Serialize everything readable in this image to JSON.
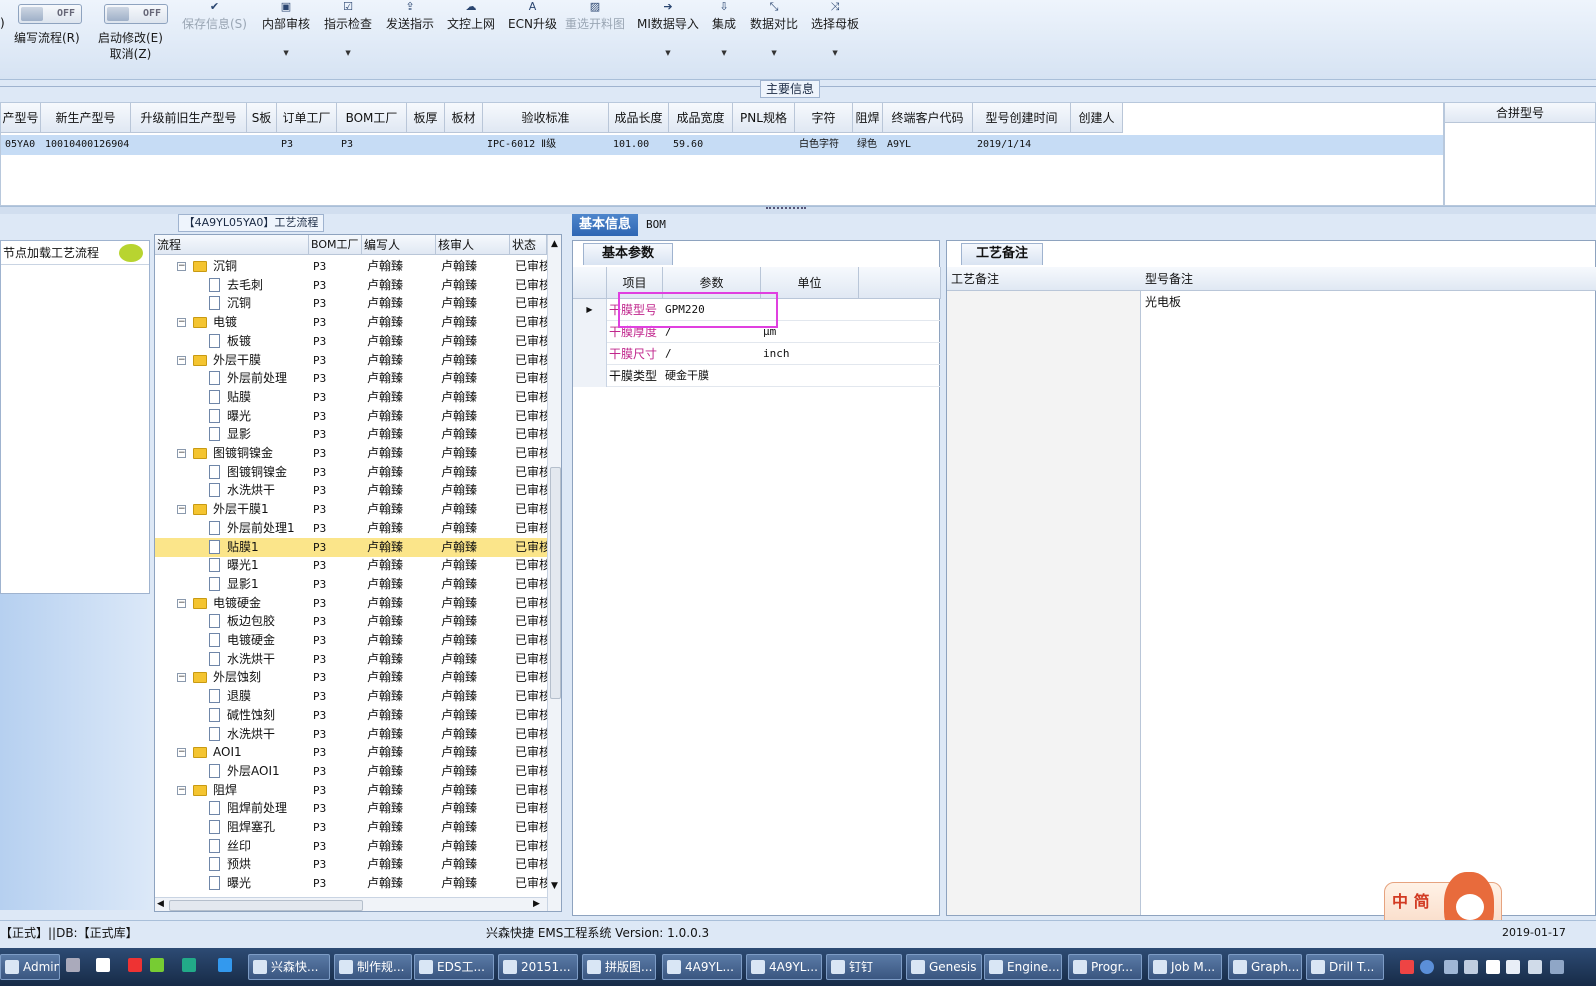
{
  "ribbon": {
    "toggle1": "OFF",
    "toggle2": "OFF",
    "btn_edit_flow": "编写流程(R)",
    "btn_start_edit": "启动修改(E)",
    "btn_cancel": "取消(Z)",
    "btn_save": "保存信息(S)",
    "btn_internal_review": "内部审核",
    "btn_check": "指示检查",
    "btn_send": "发送指示",
    "btn_upload": "文控上网",
    "btn_ecn": "ECN升级",
    "btn_reselect": "重选开料图",
    "btn_mi_import": "MI数据导入",
    "btn_integrate": "集成",
    "btn_compare": "数据对比",
    "btn_select_mother": "选择母板"
  },
  "main_info": {
    "title": "主要信息",
    "columns": [
      "产型号",
      "新生产型号",
      "升级前旧生产型号",
      "S板",
      "订单工厂",
      "BOM工厂",
      "板厚",
      "板材",
      "验收标准",
      "成品长度",
      "成品宽度",
      "PNL规格",
      "字符",
      "阻焊",
      "终端客户代码",
      "型号创建时间",
      "创建人"
    ],
    "row": [
      "05YA0",
      "10010400126904",
      "",
      "",
      "P3",
      "P3",
      "",
      "",
      "IPC-6012 Ⅱ级",
      "101.00",
      "59.60",
      "",
      "白色字符",
      "绿色",
      "A9YL",
      "2019/1/14",
      ""
    ],
    "merge_header": "合拼型号"
  },
  "left_panel": {
    "title": "节点加载工艺流程"
  },
  "tree_panel": {
    "tab": "【4A9YL05YA0】工艺流程",
    "headers": [
      "流程",
      "BOM工厂",
      "编写人",
      "核审人",
      "状态"
    ],
    "rows": [
      {
        "name": "沉铜",
        "type": "folder",
        "bom": "P3",
        "writer": "卢翰臻",
        "reviewer": "卢翰臻",
        "status": "已审核"
      },
      {
        "name": "去毛刺",
        "type": "doc",
        "bom": "P3",
        "writer": "卢翰臻",
        "reviewer": "卢翰臻",
        "status": "已审核"
      },
      {
        "name": "沉铜",
        "type": "doc",
        "bom": "P3",
        "writer": "卢翰臻",
        "reviewer": "卢翰臻",
        "status": "已审核"
      },
      {
        "name": "电镀",
        "type": "folder",
        "bom": "P3",
        "writer": "卢翰臻",
        "reviewer": "卢翰臻",
        "status": "已审核"
      },
      {
        "name": "板镀",
        "type": "doc",
        "bom": "P3",
        "writer": "卢翰臻",
        "reviewer": "卢翰臻",
        "status": "已审核"
      },
      {
        "name": "外层干膜",
        "type": "folder",
        "bom": "P3",
        "writer": "卢翰臻",
        "reviewer": "卢翰臻",
        "status": "已审核"
      },
      {
        "name": "外层前处理",
        "type": "doc",
        "bom": "P3",
        "writer": "卢翰臻",
        "reviewer": "卢翰臻",
        "status": "已审核"
      },
      {
        "name": "贴膜",
        "type": "doc",
        "bom": "P3",
        "writer": "卢翰臻",
        "reviewer": "卢翰臻",
        "status": "已审核"
      },
      {
        "name": "曝光",
        "type": "doc",
        "bom": "P3",
        "writer": "卢翰臻",
        "reviewer": "卢翰臻",
        "status": "已审核"
      },
      {
        "name": "显影",
        "type": "doc",
        "bom": "P3",
        "writer": "卢翰臻",
        "reviewer": "卢翰臻",
        "status": "已审核"
      },
      {
        "name": "图镀铜镍金",
        "type": "folder",
        "bom": "P3",
        "writer": "卢翰臻",
        "reviewer": "卢翰臻",
        "status": "已审核"
      },
      {
        "name": "图镀铜镍金",
        "type": "doc",
        "bom": "P3",
        "writer": "卢翰臻",
        "reviewer": "卢翰臻",
        "status": "已审核"
      },
      {
        "name": "水洗烘干",
        "type": "doc",
        "bom": "P3",
        "writer": "卢翰臻",
        "reviewer": "卢翰臻",
        "status": "已审核"
      },
      {
        "name": "外层干膜1",
        "type": "folder",
        "bom": "P3",
        "writer": "卢翰臻",
        "reviewer": "卢翰臻",
        "status": "已审核"
      },
      {
        "name": "外层前处理1",
        "type": "doc",
        "bom": "P3",
        "writer": "卢翰臻",
        "reviewer": "卢翰臻",
        "status": "已审核"
      },
      {
        "name": "贴膜1",
        "type": "doc",
        "bom": "P3",
        "writer": "卢翰臻",
        "reviewer": "卢翰臻",
        "status": "已审核",
        "selected": true
      },
      {
        "name": "曝光1",
        "type": "doc",
        "bom": "P3",
        "writer": "卢翰臻",
        "reviewer": "卢翰臻",
        "status": "已审核"
      },
      {
        "name": "显影1",
        "type": "doc",
        "bom": "P3",
        "writer": "卢翰臻",
        "reviewer": "卢翰臻",
        "status": "已审核"
      },
      {
        "name": "电镀硬金",
        "type": "folder",
        "bom": "P3",
        "writer": "卢翰臻",
        "reviewer": "卢翰臻",
        "status": "已审核"
      },
      {
        "name": "板边包胶",
        "type": "doc",
        "bom": "P3",
        "writer": "卢翰臻",
        "reviewer": "卢翰臻",
        "status": "已审核"
      },
      {
        "name": "电镀硬金",
        "type": "doc",
        "bom": "P3",
        "writer": "卢翰臻",
        "reviewer": "卢翰臻",
        "status": "已审核"
      },
      {
        "name": "水洗烘干",
        "type": "doc",
        "bom": "P3",
        "writer": "卢翰臻",
        "reviewer": "卢翰臻",
        "status": "已审核"
      },
      {
        "name": "外层蚀刻",
        "type": "folder",
        "bom": "P3",
        "writer": "卢翰臻",
        "reviewer": "卢翰臻",
        "status": "已审核"
      },
      {
        "name": "退膜",
        "type": "doc",
        "bom": "P3",
        "writer": "卢翰臻",
        "reviewer": "卢翰臻",
        "status": "已审核"
      },
      {
        "name": "碱性蚀刻",
        "type": "doc",
        "bom": "P3",
        "writer": "卢翰臻",
        "reviewer": "卢翰臻",
        "status": "已审核"
      },
      {
        "name": "水洗烘干",
        "type": "doc",
        "bom": "P3",
        "writer": "卢翰臻",
        "reviewer": "卢翰臻",
        "status": "已审核"
      },
      {
        "name": "AOI1",
        "type": "folder",
        "bom": "P3",
        "writer": "卢翰臻",
        "reviewer": "卢翰臻",
        "status": "已审核"
      },
      {
        "name": "外层AOI1",
        "type": "doc",
        "bom": "P3",
        "writer": "卢翰臻",
        "reviewer": "卢翰臻",
        "status": "已审核"
      },
      {
        "name": "阻焊",
        "type": "folder",
        "bom": "P3",
        "writer": "卢翰臻",
        "reviewer": "卢翰臻",
        "status": "已审核"
      },
      {
        "name": "阻焊前处理",
        "type": "doc",
        "bom": "P3",
        "writer": "卢翰臻",
        "reviewer": "卢翰臻",
        "status": "已审核"
      },
      {
        "name": "阻焊塞孔",
        "type": "doc",
        "bom": "P3",
        "writer": "卢翰臻",
        "reviewer": "卢翰臻",
        "status": "已审核"
      },
      {
        "name": "丝印",
        "type": "doc",
        "bom": "P3",
        "writer": "卢翰臻",
        "reviewer": "卢翰臻",
        "status": "已审核"
      },
      {
        "name": "预烘",
        "type": "doc",
        "bom": "P3",
        "writer": "卢翰臻",
        "reviewer": "卢翰臻",
        "status": "已审核"
      },
      {
        "name": "曝光",
        "type": "doc",
        "bom": "P3",
        "writer": "卢翰臻",
        "reviewer": "卢翰臻",
        "status": "已审核"
      }
    ]
  },
  "middle": {
    "tab_basic": "基本信息",
    "tab_bom": "BOM",
    "panel_title": "基本参数",
    "headers": [
      "项目",
      "参数",
      "单位"
    ],
    "rows": [
      {
        "item": "干膜型号",
        "param": "GPM220",
        "unit": "",
        "highlight": true
      },
      {
        "item": "干膜厚度",
        "param": "/",
        "unit": "μm",
        "highlight": true
      },
      {
        "item": "干膜尺寸",
        "param": "/",
        "unit": "inch",
        "highlight": true
      },
      {
        "item": "干膜类型",
        "param": "硬金干膜",
        "unit": "",
        "highlight": false
      }
    ]
  },
  "craft": {
    "title": "工艺备注",
    "col_craft": "工艺备注",
    "col_model": "型号备注",
    "model_value": "光电板"
  },
  "mascot": {
    "label": "中 简"
  },
  "status": {
    "left": "【正式】||DB:【正式库】",
    "center": "兴森快捷 EMS工程系统 Version: 1.0.0.3",
    "right": "2019-01-17"
  },
  "taskbar": [
    "Admin...",
    "兴森快...",
    "制作规...",
    "EDS工...",
    "20151...",
    "拼版图...",
    "4A9YL...",
    "4A9YL...",
    "钉钉",
    "Genesis",
    "Engine...",
    "Progr...",
    "Job M...",
    "Graph...",
    "Drill T..."
  ],
  "colors": {
    "accent": "#2f66b3",
    "highlight_text": "#c0268c",
    "selection": "#fbe58a",
    "highlight_box": "#e040e0"
  }
}
